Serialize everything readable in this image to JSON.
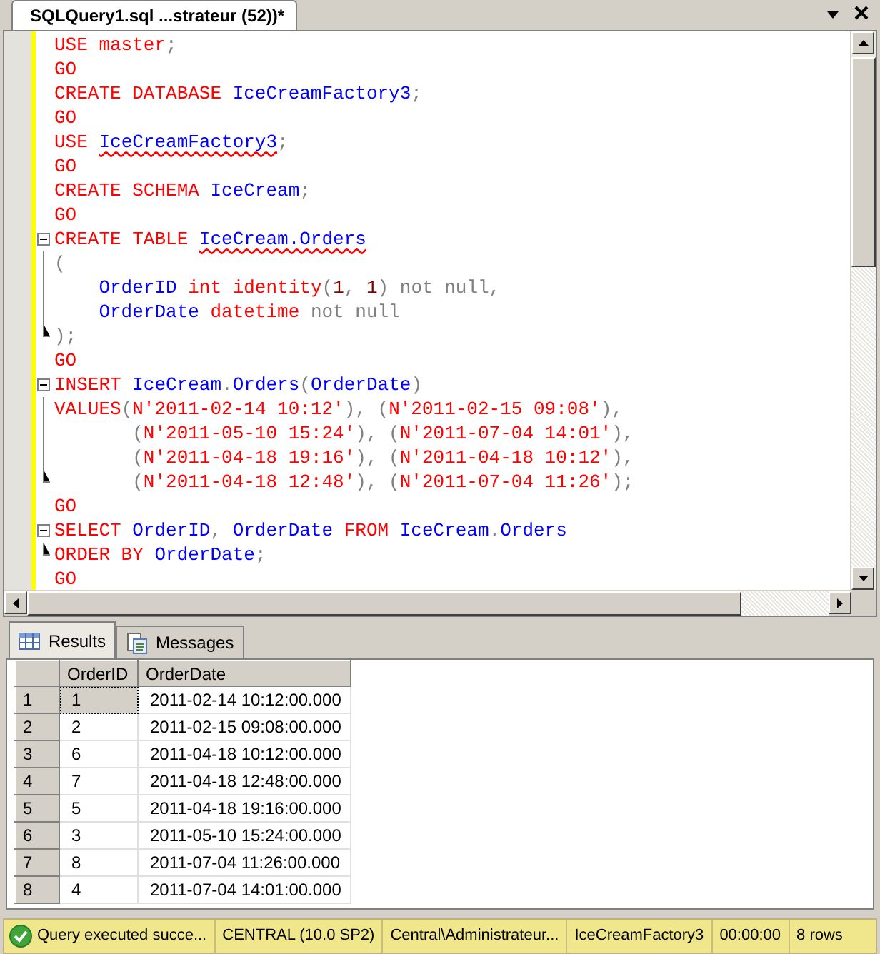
{
  "document_tab": {
    "title": "SQLQuery1.sql ...strateur (52))*",
    "selected": true
  },
  "editor": {
    "lines": [
      {
        "kind": "plain",
        "tokens": [
          {
            "t": "USE master",
            "kind": "keyword"
          },
          {
            "t": ";",
            "kind": "punct"
          }
        ]
      },
      {
        "kind": "plain",
        "tokens": [
          {
            "t": "GO",
            "kind": "keyword"
          }
        ]
      },
      {
        "kind": "plain",
        "tokens": [
          {
            "t": "CREATE DATABASE ",
            "kind": "keyword"
          },
          {
            "t": "IceCreamFactory3",
            "kind": "name"
          },
          {
            "t": ";",
            "kind": "punct"
          }
        ]
      },
      {
        "kind": "plain",
        "tokens": [
          {
            "t": "GO",
            "kind": "keyword"
          }
        ]
      },
      {
        "kind": "plain",
        "tokens": [
          {
            "t": "USE ",
            "kind": "keyword"
          },
          {
            "t": "IceCreamFactory3",
            "kind": "flagged"
          },
          {
            "t": ";",
            "kind": "punct"
          }
        ]
      },
      {
        "kind": "plain",
        "tokens": [
          {
            "t": "GO",
            "kind": "keyword"
          }
        ]
      },
      {
        "kind": "plain",
        "tokens": [
          {
            "t": "CREATE SCHEMA ",
            "kind": "keyword"
          },
          {
            "t": "IceCream",
            "kind": "name"
          },
          {
            "t": ";",
            "kind": "punct"
          }
        ]
      },
      {
        "kind": "plain",
        "tokens": [
          {
            "t": "GO",
            "kind": "keyword"
          }
        ]
      },
      {
        "kind": "open",
        "tokens": [
          {
            "t": "CREATE TABLE ",
            "kind": "keyword"
          },
          {
            "t": "IceCream.Orders",
            "kind": "flagged"
          }
        ]
      },
      {
        "kind": "inner",
        "tokens": [
          {
            "t": "(",
            "kind": "punct"
          }
        ]
      },
      {
        "kind": "inner",
        "tokens": [
          {
            "t": "    OrderID",
            "kind": "name"
          },
          {
            "t": " int identity",
            "kind": "keyword"
          },
          {
            "t": "(",
            "kind": "punct"
          },
          {
            "t": "1",
            "kind": "number"
          },
          {
            "t": ", ",
            "kind": "punct"
          },
          {
            "t": "1",
            "kind": "number"
          },
          {
            "t": ") not null,",
            "kind": "punct"
          }
        ]
      },
      {
        "kind": "inner",
        "tokens": [
          {
            "t": "    OrderDate",
            "kind": "name"
          },
          {
            "t": " datetime",
            "kind": "keyword"
          },
          {
            "t": " not null",
            "kind": "punct"
          }
        ]
      },
      {
        "kind": "close",
        "tokens": [
          {
            "t": ");",
            "kind": "punct"
          }
        ]
      },
      {
        "kind": "plain",
        "tokens": [
          {
            "t": "GO",
            "kind": "keyword"
          }
        ]
      },
      {
        "kind": "open",
        "tokens": [
          {
            "t": "INSERT ",
            "kind": "keyword"
          },
          {
            "t": "IceCream",
            "kind": "name"
          },
          {
            "t": ".",
            "kind": "punct"
          },
          {
            "t": "Orders",
            "kind": "name"
          },
          {
            "t": "(",
            "kind": "punct"
          },
          {
            "t": "OrderDate",
            "kind": "name"
          },
          {
            "t": ")",
            "kind": "punct"
          }
        ]
      },
      {
        "kind": "inner",
        "tokens": [
          {
            "t": "VALUES",
            "kind": "keyword"
          },
          {
            "t": "(",
            "kind": "punct"
          },
          {
            "t": "N'2011-02-14 10:12'",
            "kind": "string"
          },
          {
            "t": "), (",
            "kind": "punct"
          },
          {
            "t": "N'2011-02-15 09:08'",
            "kind": "string"
          },
          {
            "t": "),",
            "kind": "punct"
          }
        ]
      },
      {
        "kind": "inner",
        "tokens": [
          {
            "t": "       (",
            "kind": "punct"
          },
          {
            "t": "N'2011-05-10 15:24'",
            "kind": "string"
          },
          {
            "t": "), (",
            "kind": "punct"
          },
          {
            "t": "N'2011-07-04 14:01'",
            "kind": "string"
          },
          {
            "t": "),",
            "kind": "punct"
          }
        ]
      },
      {
        "kind": "inner",
        "tokens": [
          {
            "t": "       (",
            "kind": "punct"
          },
          {
            "t": "N'2011-04-18 19:16'",
            "kind": "string"
          },
          {
            "t": "), (",
            "kind": "punct"
          },
          {
            "t": "N'2011-04-18 10:12'",
            "kind": "string"
          },
          {
            "t": "),",
            "kind": "punct"
          }
        ]
      },
      {
        "kind": "close",
        "tokens": [
          {
            "t": "       (",
            "kind": "punct"
          },
          {
            "t": "N'2011-04-18 12:48'",
            "kind": "string"
          },
          {
            "t": "), (",
            "kind": "punct"
          },
          {
            "t": "N'2011-07-04 11:26'",
            "kind": "string"
          },
          {
            "t": ");",
            "kind": "punct"
          }
        ]
      },
      {
        "kind": "plain",
        "tokens": [
          {
            "t": "GO",
            "kind": "keyword"
          }
        ]
      },
      {
        "kind": "open",
        "tokens": [
          {
            "t": "SELECT ",
            "kind": "keyword"
          },
          {
            "t": "OrderID",
            "kind": "name"
          },
          {
            "t": ", ",
            "kind": "punct"
          },
          {
            "t": "OrderDate ",
            "kind": "name"
          },
          {
            "t": "FROM ",
            "kind": "keyword"
          },
          {
            "t": "IceCream",
            "kind": "name"
          },
          {
            "t": ".",
            "kind": "punct"
          },
          {
            "t": "Orders",
            "kind": "name"
          }
        ]
      },
      {
        "kind": "close",
        "tokens": [
          {
            "t": "ORDER BY ",
            "kind": "keyword"
          },
          {
            "t": "OrderDate",
            "kind": "name"
          },
          {
            "t": ";",
            "kind": "punct"
          }
        ]
      },
      {
        "kind": "plain",
        "tokens": [
          {
            "t": "GO",
            "kind": "keyword"
          }
        ]
      }
    ]
  },
  "result_tabs": [
    {
      "label": "Results",
      "kind": "grid",
      "selected": true
    },
    {
      "label": "Messages",
      "kind": "messages",
      "selected": false
    }
  ],
  "results": {
    "columns": [
      "OrderID",
      "OrderDate"
    ],
    "rows": [
      {
        "num": "1",
        "cells": [
          "1",
          "2011-02-14 10:12:00.000"
        ],
        "selected": true
      },
      {
        "num": "2",
        "cells": [
          "2",
          "2011-02-15 09:08:00.000"
        ],
        "selected": false
      },
      {
        "num": "3",
        "cells": [
          "6",
          "2011-04-18 10:12:00.000"
        ],
        "selected": false
      },
      {
        "num": "4",
        "cells": [
          "7",
          "2011-04-18 12:48:00.000"
        ],
        "selected": false
      },
      {
        "num": "5",
        "cells": [
          "5",
          "2011-04-18 19:16:00.000"
        ],
        "selected": false
      },
      {
        "num": "6",
        "cells": [
          "3",
          "2011-05-10 15:24:00.000"
        ],
        "selected": false
      },
      {
        "num": "7",
        "cells": [
          "8",
          "2011-07-04 11:26:00.000"
        ],
        "selected": false
      },
      {
        "num": "8",
        "cells": [
          "4",
          "2011-07-04 14:01:00.000"
        ],
        "selected": false
      }
    ]
  },
  "status_bar": {
    "message": "Query executed succe...",
    "server": "CENTRAL (10.0 SP2)",
    "user": "Central\\Administrateur...",
    "database": "IceCreamFactory3",
    "elapsed": "00:00:00",
    "rows": "8 rows"
  }
}
